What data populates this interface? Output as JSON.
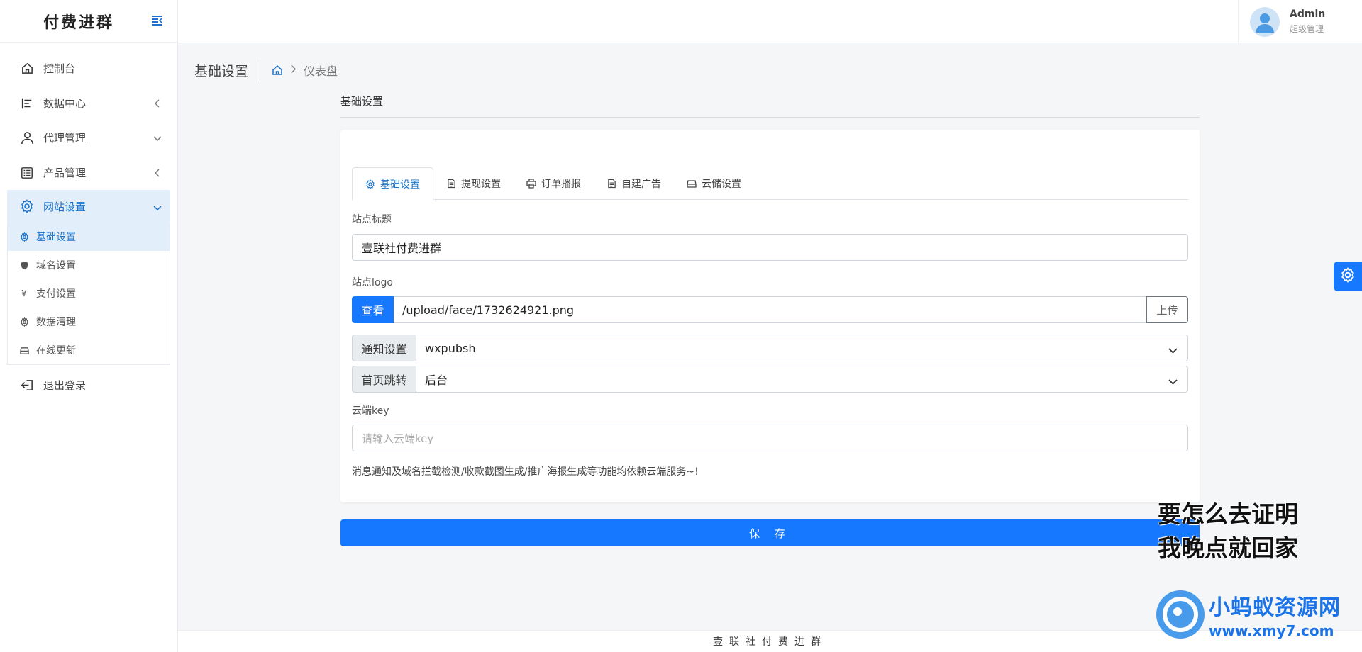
{
  "brand": {
    "title": "付费进群"
  },
  "sidebar": {
    "items": [
      {
        "label": "控制台",
        "icon": "home-icon"
      },
      {
        "label": "数据中心",
        "icon": "bar-list-icon"
      },
      {
        "label": "代理管理",
        "icon": "user-icon"
      },
      {
        "label": "产品管理",
        "icon": "list-icon"
      },
      {
        "label": "网站设置",
        "icon": "gear-icon"
      }
    ],
    "submenu": [
      {
        "label": "基础设置",
        "icon": "gear-icon",
        "active": true
      },
      {
        "label": "域名设置",
        "icon": "shield-icon"
      },
      {
        "label": "支付设置",
        "icon": "yen-icon"
      },
      {
        "label": "数据清理",
        "icon": "gear-icon"
      },
      {
        "label": "在线更新",
        "icon": "drive-icon"
      }
    ],
    "logout": "退出登录"
  },
  "user": {
    "name": "Admin",
    "role": "超级管理"
  },
  "header": {
    "title": "基础设置",
    "breadcrumb": "仪表盘"
  },
  "section": {
    "title": "基础设置"
  },
  "tabs": [
    {
      "label": "基础设置",
      "icon": "gear-icon",
      "active": true
    },
    {
      "label": "提现设置",
      "icon": "document-icon"
    },
    {
      "label": "订单播报",
      "icon": "printer-icon"
    },
    {
      "label": "自建广告",
      "icon": "document-icon"
    },
    {
      "label": "云储设置",
      "icon": "drive-icon"
    }
  ],
  "form": {
    "site_title_label": "站点标题",
    "site_title_value": "壹联社付费进群",
    "site_logo_label": "站点logo",
    "view_button": "查看",
    "logo_path": "/upload/face/1732624921.png",
    "upload_button": "上传",
    "notify_label": "通知设置",
    "notify_value": "wxpubsh",
    "home_redirect_label": "首页跳转",
    "home_redirect_value": "后台",
    "cloud_key_label": "云端key",
    "cloud_key_placeholder": "请输入云端key",
    "note": "消息通知及域名拦截检测/收款截图生成/推广海报生成等功能均依赖云端服务~!"
  },
  "save_button": "保 存",
  "footer": {
    "text": "壹联社付费进群"
  },
  "overlay": {
    "caption_line1": "要怎么去证明",
    "caption_line2": "我晚点就回家",
    "watermark_title": "小蚂蚁资源网",
    "watermark_url": "www.xmy7.com"
  },
  "colors": {
    "primary": "#1677ff",
    "active_bg": "#e3eefb",
    "active_text": "#1a73c9"
  }
}
